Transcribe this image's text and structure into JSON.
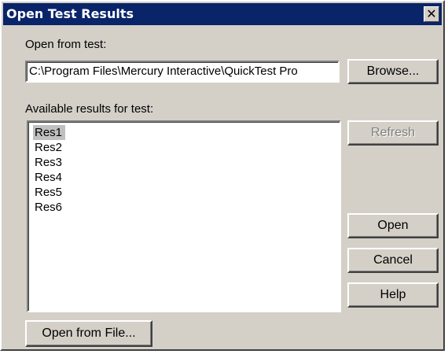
{
  "window": {
    "title": "Open Test Results"
  },
  "open_from": {
    "label": "Open from test:",
    "path_value": "C:\\Program Files\\Mercury Interactive\\QuickTest Pro",
    "browse_label": "Browse..."
  },
  "results": {
    "label": "Available results for test:",
    "items": [
      "Res1",
      "Res2",
      "Res3",
      "Res4",
      "Res5",
      "Res6"
    ],
    "selected": "Res1"
  },
  "buttons": {
    "refresh": "Refresh",
    "open": "Open",
    "cancel": "Cancel",
    "help": "Help",
    "open_from_file": "Open from File..."
  },
  "icons": {
    "close": "close-icon"
  },
  "colors": {
    "titlebar": "#0a246a",
    "face": "#d4d0c8",
    "selection": "#c0c0c0"
  }
}
